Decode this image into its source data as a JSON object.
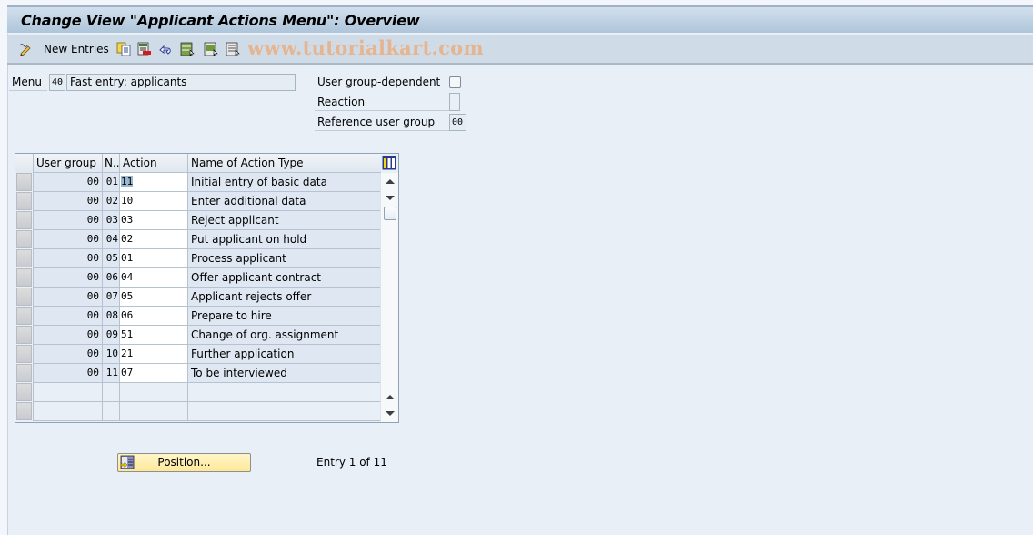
{
  "window": {
    "title": "Change View \"Applicant Actions Menu\": Overview"
  },
  "toolbar": {
    "new_entries_label": "New Entries",
    "icons": [
      "display-change-icon",
      "copy-icon",
      "delete-icon",
      "undo-icon",
      "select-all-icon",
      "select-block-icon",
      "deselect-all-icon"
    ],
    "watermark": "www.tutorialkart.com"
  },
  "header": {
    "menu_label": "Menu",
    "menu_code": "40",
    "menu_text": "Fast entry: applicants",
    "user_group_dependent_label": "User group-dependent",
    "user_group_dependent_checked": false,
    "reaction_label": "Reaction",
    "reaction_value": "",
    "reference_user_group_label": "Reference user group",
    "reference_user_group_value": "00"
  },
  "table": {
    "columns": [
      "User group",
      "N..",
      "Action",
      "Name of Action Type"
    ],
    "rows": [
      {
        "user_group": "00",
        "no": "01",
        "action": "11",
        "name": "Initial entry of basic data"
      },
      {
        "user_group": "00",
        "no": "02",
        "action": "10",
        "name": "Enter additional data"
      },
      {
        "user_group": "00",
        "no": "03",
        "action": "03",
        "name": "Reject applicant"
      },
      {
        "user_group": "00",
        "no": "04",
        "action": "02",
        "name": "Put applicant on hold"
      },
      {
        "user_group": "00",
        "no": "05",
        "action": "01",
        "name": "Process applicant"
      },
      {
        "user_group": "00",
        "no": "06",
        "action": "04",
        "name": "Offer applicant contract"
      },
      {
        "user_group": "00",
        "no": "07",
        "action": "05",
        "name": "Applicant rejects offer"
      },
      {
        "user_group": "00",
        "no": "08",
        "action": "06",
        "name": "Prepare to hire"
      },
      {
        "user_group": "00",
        "no": "09",
        "action": "51",
        "name": "Change of org. assignment"
      },
      {
        "user_group": "00",
        "no": "10",
        "action": "21",
        "name": "Further application"
      },
      {
        "user_group": "00",
        "no": "11",
        "action": "07",
        "name": "To be interviewed"
      }
    ],
    "empty_rows": 2
  },
  "footer": {
    "position_button_label": "Position...",
    "entry_status": "Entry 1 of 11"
  }
}
